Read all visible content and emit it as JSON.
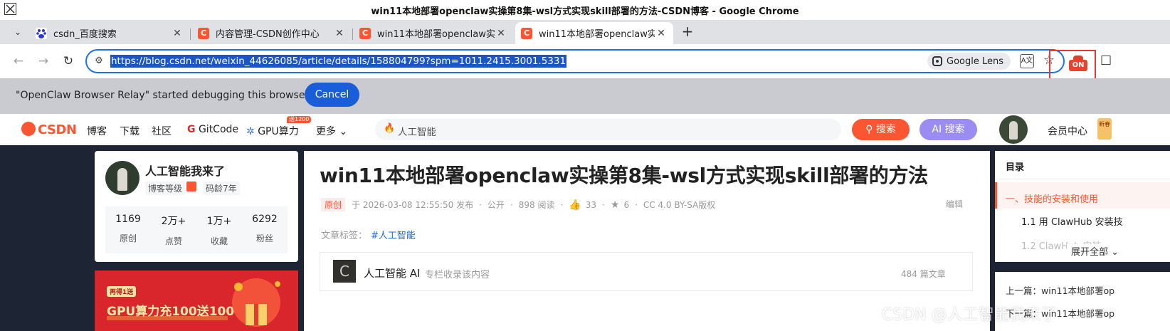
{
  "window": {
    "title": "win11本地部署openclaw实操第8集-wsl方式实现skill部署的方法-CSDN博客 - Google Chrome"
  },
  "tabs": [
    {
      "label": "csdn_百度搜索",
      "favicon": "baidu-icon"
    },
    {
      "label": "内容管理-CSDN创作中心",
      "favicon": "csdn-icon"
    },
    {
      "label": "win11本地部署openclaw实",
      "favicon": "csdn-icon"
    },
    {
      "label": "win11本地部署openclaw实",
      "favicon": "csdn-icon",
      "active": true
    }
  ],
  "toolbar": {
    "url": "https://blog.csdn.net/weixin_44626085/article/details/158804799?spm=1011.2415.3001.5331",
    "lens_label": "Google Lens",
    "extension_badge": "ON"
  },
  "infobar": {
    "message": "\"OpenClaw Browser Relay\" started debugging this browser",
    "cancel_label": "Cancel"
  },
  "csdn_nav": {
    "logo": "CSDN",
    "items": [
      "博客",
      "下载",
      "社区",
      "GitCode",
      "GPU算力",
      "更多"
    ],
    "gpu_badge": "送1200",
    "search_query": "人工智能",
    "search_button": "搜索",
    "ai_button": "AI 搜索",
    "vip": "会员中心",
    "vip_badge": "新春"
  },
  "profile": {
    "name": "人工智能我来了",
    "level_label": "博客等级",
    "code_age": "码龄7年",
    "stats": [
      {
        "value": "1169",
        "label": "原创"
      },
      {
        "value": "2万+",
        "label": "点赞"
      },
      {
        "value": "1万+",
        "label": "收藏"
      },
      {
        "value": "6292",
        "label": "粉丝"
      }
    ]
  },
  "ad": {
    "tag": "再得1送",
    "headline": "GPU算力充100送100"
  },
  "article": {
    "title": "win11本地部署openclaw实操第8集-wsl方式实现skill部署的方法",
    "original": "原创",
    "published": "于 2026-03-08 12:55:50 发布",
    "visibility": "公开",
    "reads": "898 阅读",
    "likes": "33",
    "favorites": "6",
    "license": "CC 4.0 BY-SA版权",
    "edit": "编辑",
    "tags_label": "文章标签：",
    "tag": "#人工智能",
    "column_name": "人工智能 AI",
    "column_note": "专栏收录该内容",
    "column_count": "484 篇文章"
  },
  "toc": {
    "heading": "目录",
    "item1": "一、技能的安装和使用",
    "item2": "1.1 用 ClawHub 安装技",
    "item3": "1.2 ClawHub 安装",
    "expand": "展开全部"
  },
  "related": {
    "prev": "上一篇：win11本地部署op",
    "next": "下一篇：win11本地部署op"
  },
  "watermark": "CSDN @人工智能我来了",
  "colors": {
    "csdn_red": "#fc5531",
    "chrome_blue": "#1a73e8",
    "ai_purple": "#9b8cf4"
  }
}
